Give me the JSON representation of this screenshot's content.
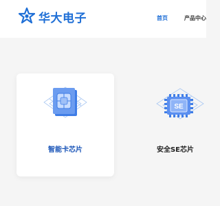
{
  "brand": {
    "name": "华大电子",
    "logo_icon": "star-logo-icon",
    "color": "#1f6fd6"
  },
  "nav": {
    "items": [
      {
        "label": "首页",
        "active": true
      },
      {
        "label": "产品中心",
        "active": false
      }
    ]
  },
  "products": [
    {
      "title": "智能卡芯片",
      "icon": "smart-card-chip-icon"
    },
    {
      "title": "安全SE芯片",
      "icon": "se-chip-icon",
      "chip_label": "SE"
    }
  ]
}
